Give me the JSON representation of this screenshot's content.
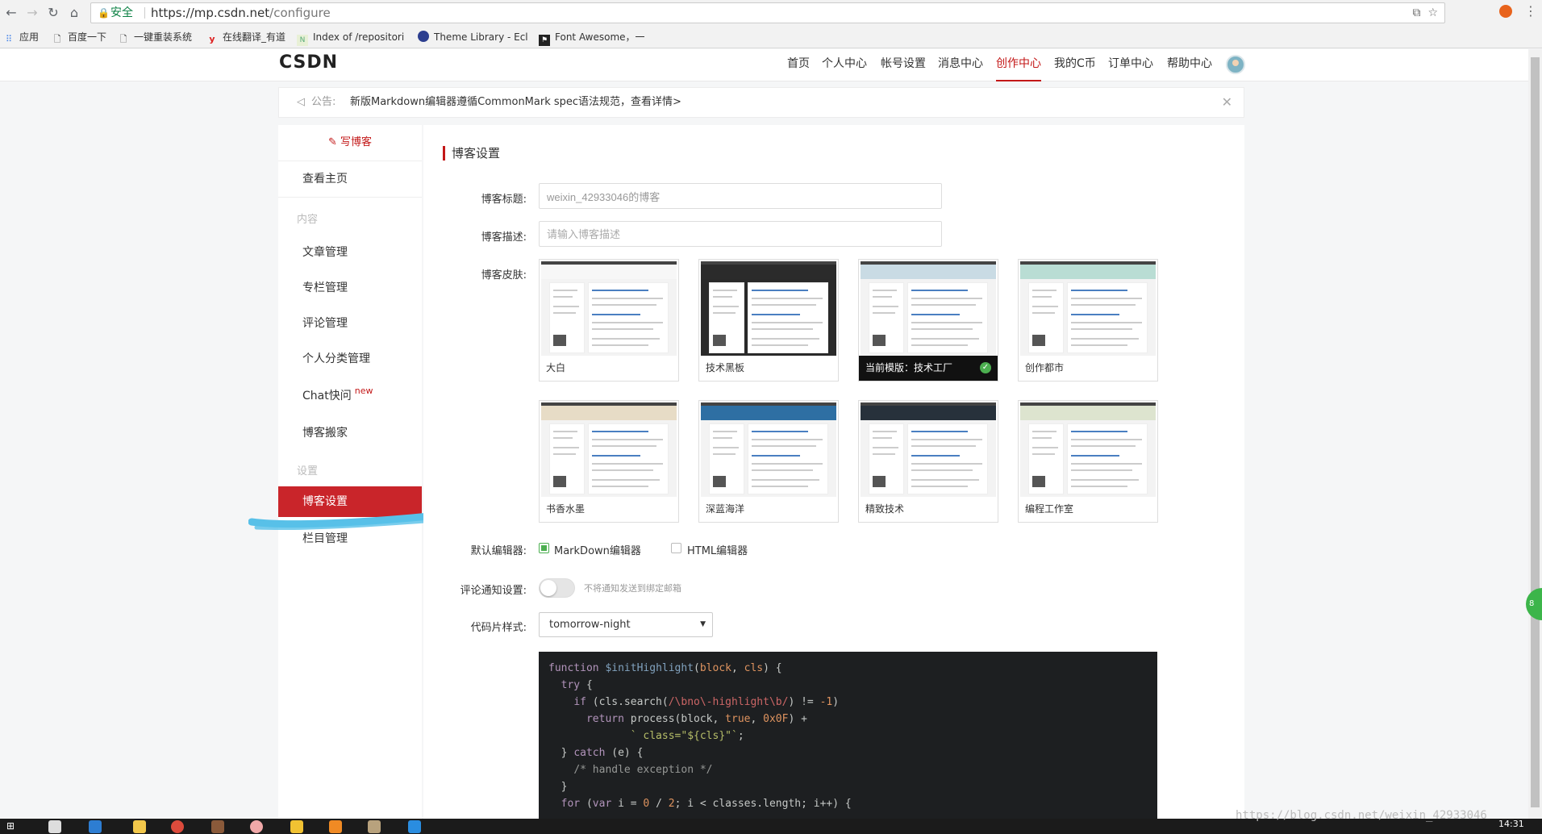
{
  "browser": {
    "secure_label": "安全",
    "url_host": "https://mp.csdn.net",
    "url_path": "/configure",
    "bookmarks": [
      {
        "label": "应用"
      },
      {
        "label": "百度一下"
      },
      {
        "label": "一键重装系统"
      },
      {
        "label": "在线翻译_有道"
      },
      {
        "label": "Index of /repositori"
      },
      {
        "label": "Theme Library - Ecl"
      },
      {
        "label": "Font Awesome，一"
      }
    ]
  },
  "header": {
    "logo": "CSDN",
    "nav": [
      "首页",
      "个人中心",
      "帐号设置",
      "消息中心",
      "创作中心",
      "我的C币",
      "订单中心",
      "帮助中心"
    ],
    "active_nav": "创作中心"
  },
  "notice": {
    "label": "公告:",
    "text": "新版Markdown编辑器遵循CommonMark spec语法规范，查看详情>"
  },
  "sidebar": {
    "write": "写博客",
    "home": "查看主页",
    "group_content": "内容",
    "content_items": [
      "文章管理",
      "专栏管理",
      "评论管理",
      "个人分类管理",
      "Chat快问",
      "博客搬家"
    ],
    "chat_badge": "new",
    "group_settings": "设置",
    "settings_items": [
      "博客设置",
      "栏目管理"
    ]
  },
  "main": {
    "title": "博客设置",
    "blog_title_label": "博客标题:",
    "blog_title_value": "weixin_42933046的博客",
    "blog_desc_label": "博客描述:",
    "blog_desc_placeholder": "请输入博客描述",
    "skin_label": "博客皮肤:",
    "skins": [
      {
        "name": "大白",
        "band": "#f7f7f7"
      },
      {
        "name": "技术黑板",
        "band": "#2b2b2b"
      },
      {
        "name": "当前模版：技术工厂",
        "band": "#c9dbe4"
      },
      {
        "name": "创作都市",
        "band": "#b9ddd4"
      },
      {
        "name": "书香水墨",
        "band": "#e7dcc6"
      },
      {
        "name": "深蓝海洋",
        "band": "#2e6fa3"
      },
      {
        "name": "精致技术",
        "band": "#27313b"
      },
      {
        "name": "编程工作室",
        "band": "#dde4cf"
      }
    ],
    "editor_label": "默认编辑器:",
    "editor_options": [
      "MarkDown编辑器",
      "HTML编辑器"
    ],
    "comment_label": "评论通知设置:",
    "comment_hint": "不将通知发送到绑定邮箱",
    "code_style_label": "代码片样式:",
    "code_style_value": "tomorrow-night"
  },
  "taskbar": {
    "watermark": "https://blog.csdn.net/weixin_42933046",
    "clock": "14:31"
  },
  "colors": {
    "brand_red": "#c31818",
    "active_bg": "#c9252a",
    "code_bg": "#1d1f21"
  }
}
